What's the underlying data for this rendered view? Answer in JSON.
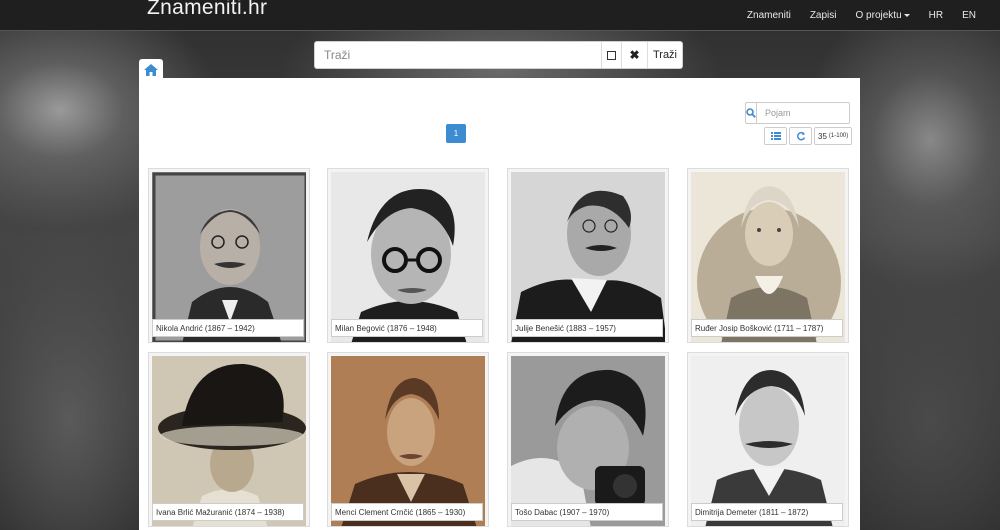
{
  "brand": "Znameniti.hr",
  "nav": [
    {
      "label": "Znameniti"
    },
    {
      "label": "Zapisi"
    },
    {
      "label": "O projektu"
    },
    {
      "label": "HR"
    },
    {
      "label": "EN"
    }
  ],
  "search": {
    "placeholder": "Traži",
    "button": "Traži",
    "clear": "✖"
  },
  "filter": {
    "placeholder": "Pojam"
  },
  "pagination": {
    "current": "1"
  },
  "results": {
    "count": "35",
    "range": "(1-100)"
  },
  "people": [
    {
      "caption": "Nikola Andrić (1867 – 1942)"
    },
    {
      "caption": "Milan Begović (1876 – 1948)"
    },
    {
      "caption": "Julije Benešić (1883 – 1957)"
    },
    {
      "caption": "Ruđer Josip Bošković (1711 – 1787)"
    },
    {
      "caption": "Ivana Brlić Mažuranić (1874 – 1938)"
    },
    {
      "caption": "Menci Clement Crnčić (1865 – 1930)"
    },
    {
      "caption": "Tošo Dabac (1907 – 1970)"
    },
    {
      "caption": "Dimitrija Demeter (1811 – 1872)"
    }
  ],
  "colors": {
    "accent": "#3d8bd0",
    "navbar": "#1f1f1f"
  }
}
